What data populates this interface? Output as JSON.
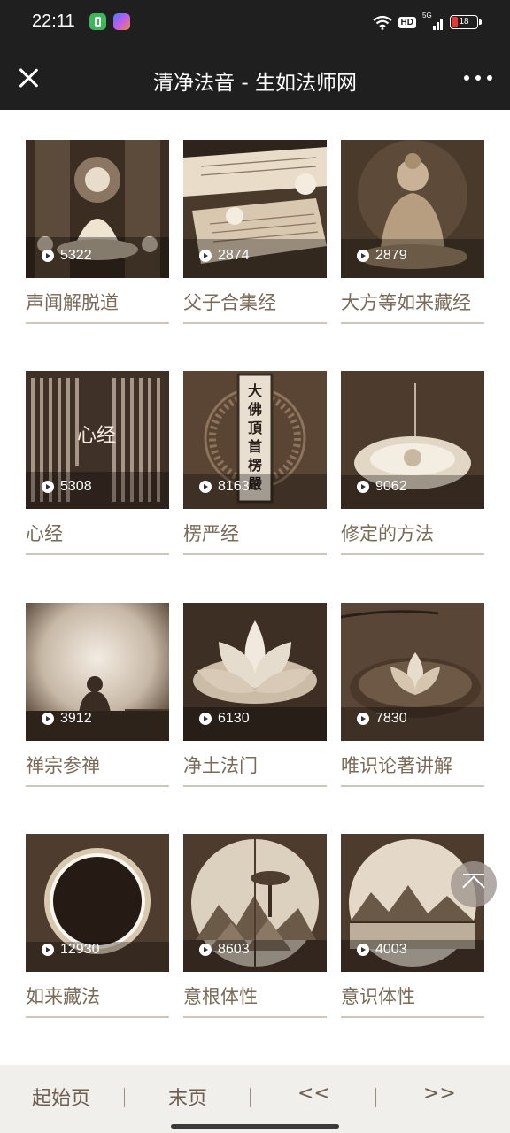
{
  "status_bar": {
    "time": "22:11",
    "network_badge": "HD",
    "signal_type": "5G",
    "battery_level": "18"
  },
  "title_bar": {
    "title": "清净法音 - 生如法师网"
  },
  "cards": [
    {
      "title": "声闻解脱道",
      "plays": "5322"
    },
    {
      "title": "父子合集经",
      "plays": "2874"
    },
    {
      "title": "大方等如来藏经",
      "plays": "2879"
    },
    {
      "title": "心经",
      "plays": "5308"
    },
    {
      "title": "楞严经",
      "plays": "8163"
    },
    {
      "title": "修定的方法",
      "plays": "9062"
    },
    {
      "title": "禅宗参禅",
      "plays": "3912"
    },
    {
      "title": "净土法门",
      "plays": "6130"
    },
    {
      "title": "唯识论著讲解",
      "plays": "7830"
    },
    {
      "title": "如来藏法",
      "plays": "12930"
    },
    {
      "title": "意根体性",
      "plays": "8603"
    },
    {
      "title": "意识体性",
      "plays": "4003"
    }
  ],
  "thumb_text": {
    "heart_sutra": "心经",
    "surangama": [
      "大",
      "佛",
      "頂",
      "首",
      "楞",
      "嚴"
    ]
  },
  "pager": {
    "first": "起始页",
    "last": "末页",
    "prev": "<<",
    "next": ">>"
  },
  "colors": {
    "bar_bg": "#1f1f1f",
    "title_text": "#7a6a58",
    "pager_bg": "#f1efec"
  }
}
